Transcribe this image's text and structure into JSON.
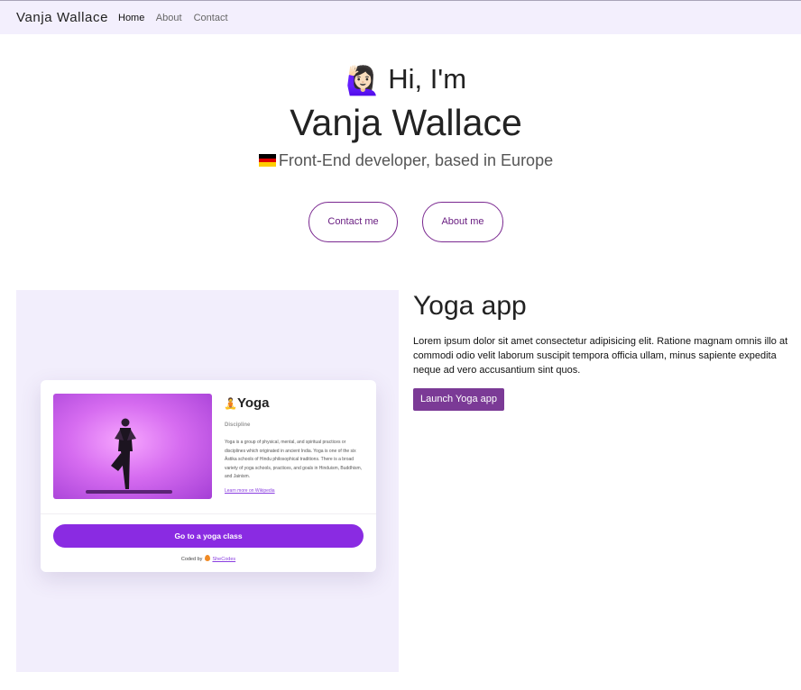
{
  "nav": {
    "brand": "Vanja Wallace",
    "links": [
      "Home",
      "About",
      "Contact"
    ]
  },
  "hero": {
    "greeting_emoji": "🙋🏻‍♀️",
    "greeting": "Hi, I'm",
    "name": "Vanja Wallace",
    "tagline": "Front-End developer, based in Europe"
  },
  "buttons": {
    "contact": "Contact me",
    "about": "About me"
  },
  "project": {
    "title": "Yoga app",
    "description": "Lorem ipsum dolor sit amet consectetur adipisicing elit. Ratione magnam omnis illo at commodi odio velit laborum suscipit tempora officia ullam, minus sapiente expedita neque ad vero accusantium sint quos.",
    "launch_label": "Launch Yoga app"
  },
  "preview": {
    "emoji": "🧘",
    "title": "Yoga",
    "subtitle": "Discipline",
    "body": "Yoga is a group of physical, mental, and spiritual practices or disciplines which originated in ancient India. Yoga is one of the six Āstika schools of Hindu philosophical traditions. There is a broad variety of yoga schools, practices, and goals in Hinduism, Buddhism, and Jainism.",
    "link": "Learn more on Wikipedia",
    "cta": "Go to a yoga class",
    "coded_by": "Coded by",
    "coded_by_name": "SheCodes"
  },
  "colors": {
    "nav_bg": "#f3effd",
    "accent": "#7b3a96",
    "preview_bg": "#f2eefc",
    "cta_purple": "#8a2be2"
  }
}
